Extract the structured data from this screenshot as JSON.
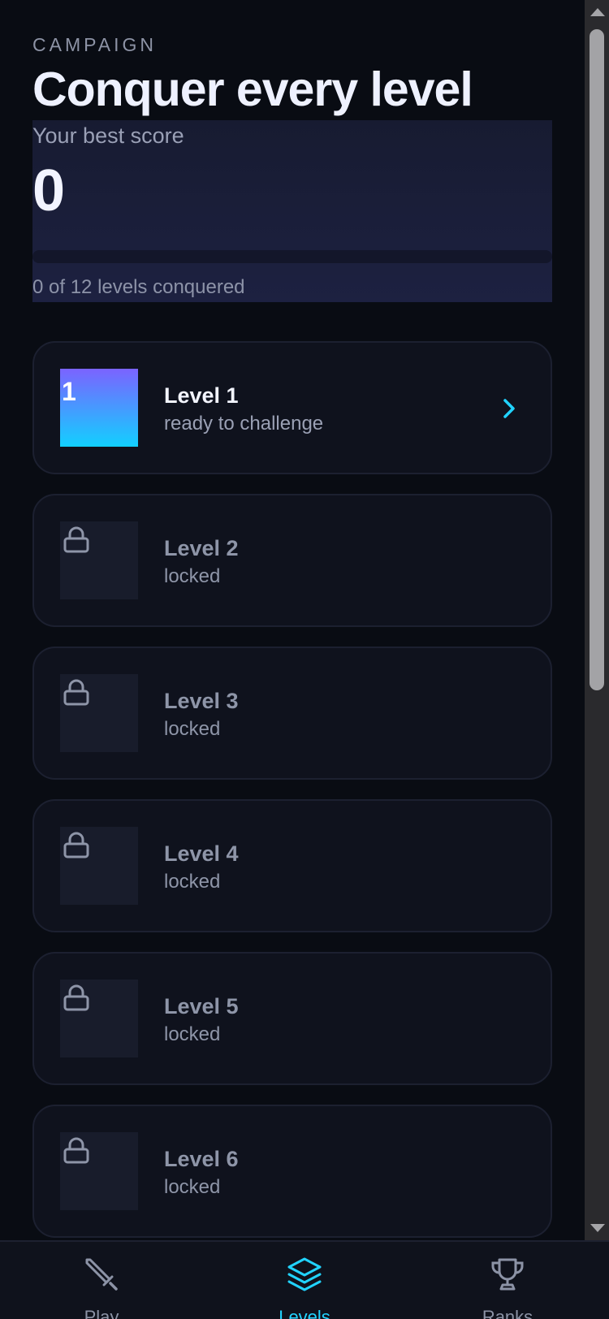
{
  "header": {
    "eyebrow": "CAMPAIGN",
    "title": "Conquer every level"
  },
  "score": {
    "label": "Your best score",
    "value": "0",
    "progress_fraction": 0,
    "progress_text": "0 of 12 levels conquered"
  },
  "levels": [
    {
      "number": "1",
      "name": "Level 1",
      "status": "ready to challenge",
      "locked": false,
      "icon": "chevron-right-icon"
    },
    {
      "name": "Level 2",
      "status": "locked",
      "locked": true,
      "icon": "lock-icon"
    },
    {
      "name": "Level 3",
      "status": "locked",
      "locked": true,
      "icon": "lock-icon"
    },
    {
      "name": "Level 4",
      "status": "locked",
      "locked": true,
      "icon": "lock-icon"
    },
    {
      "name": "Level 5",
      "status": "locked",
      "locked": true,
      "icon": "lock-icon"
    },
    {
      "name": "Level 6",
      "status": "locked",
      "locked": true,
      "icon": "lock-icon"
    }
  ],
  "nav": {
    "items": [
      {
        "label": "Play",
        "icon": "sword-icon",
        "active": false
      },
      {
        "label": "Levels",
        "icon": "layers-icon",
        "active": true
      },
      {
        "label": "Ranks",
        "icon": "trophy-icon",
        "active": false
      }
    ]
  },
  "colors": {
    "accent": "#21d3ff",
    "background": "#090c13",
    "card": "#0f121d",
    "gradient_start": "#7b63ff",
    "gradient_end": "#12d0ff"
  }
}
